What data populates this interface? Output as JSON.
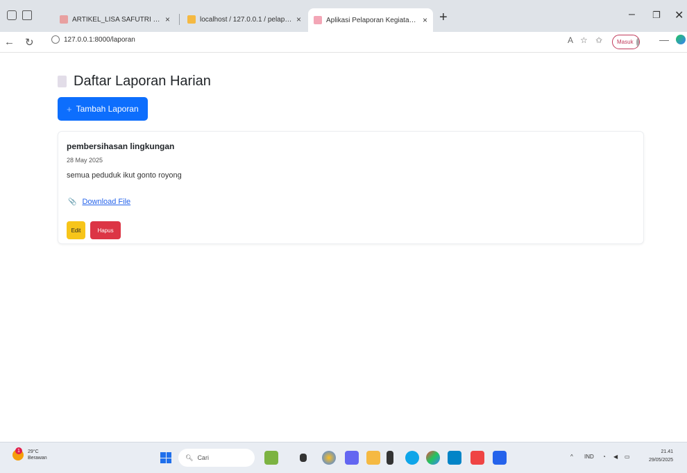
{
  "browser": {
    "tabs": [
      {
        "title": "ARTIKEL_LISA SAFUTRI Penerapan",
        "active": false
      },
      {
        "title": "localhost / 127.0.0.1 / pelaporan",
        "active": false
      },
      {
        "title": "Aplikasi Pelaporan Kegiatan KKN",
        "active": true
      }
    ],
    "new_tab": "+",
    "url": "127.0.0.1:8000/laporan",
    "profile_label": "Masuk"
  },
  "page": {
    "title": "Daftar Laporan Harian",
    "add_button": "Tambah Laporan",
    "reports": [
      {
        "title": "pembersihasan lingkungan",
        "date": "28 May 2025",
        "description": "semua peduduk ikut gonto royong",
        "download_label": "Download File",
        "edit_label": "Edit",
        "delete_label": "Hapus"
      }
    ]
  },
  "taskbar": {
    "weather_temp": "29°C",
    "weather_desc": "Berawan",
    "search_placeholder": "Cari",
    "language": "IND",
    "time": "21.41",
    "date": "29/05/2025"
  },
  "colors": {
    "primary": "#0d6efd",
    "warning": "#f7c51a",
    "danger": "#dc3545"
  }
}
